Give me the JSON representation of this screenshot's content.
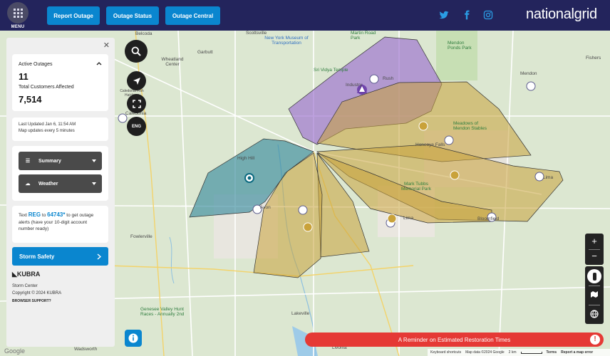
{
  "header": {
    "menu_label": "MENU",
    "nav": [
      "Report Outage",
      "Outage Status",
      "Outage Central"
    ],
    "brand": "nationalgrid",
    "social_icons": [
      "twitter-icon",
      "facebook-icon",
      "instagram-icon"
    ]
  },
  "panel": {
    "active_outages_label": "Active Outages",
    "active_outages": "11",
    "customers_label": "Total Customers Affected",
    "customers": "7,514",
    "last_updated": "Last Updated Jan 6, 11:54 AM",
    "update_freq": "Map updates every 5 minutes",
    "summary_label": "Summary",
    "weather_label": "Weather",
    "text_prefix": "Text",
    "text_keyword": "REG",
    "text_to": "to",
    "text_number": "64743*",
    "text_suffix": "to get outage alerts (have your 10-digit account number ready)",
    "storm_safety": "Storm Safety",
    "kubra": "KUBRA",
    "storm_center": "Storm Center",
    "copyright": "Copyright © 2024 KUBRA",
    "browser_support": "BROWSER SUPPORT?"
  },
  "controls": {
    "lang": "ENG",
    "zoom_in": "+",
    "zoom_out": "−"
  },
  "banner": {
    "reminder": "A Reminder on Estimated Restoration Times"
  },
  "map_footer": {
    "shortcuts": "Keyboard shortcuts",
    "map_data": "Map data ©2024 Google",
    "scale": "2 km",
    "terms": "Terms",
    "report": "Report a map error",
    "google": "Google"
  },
  "map_labels": [
    "Belcoda",
    "Scottsville",
    "New York Museum of Transportation",
    "Martin Road Park",
    "Garbutt",
    "Wheatland Center",
    "Sri Vidya Temple",
    "Rush",
    "Industry",
    "Caledonia",
    "Caledonia Fish Hatchery",
    "High Hill",
    "Fowlerville",
    "Genesee Valley Hunt Races - Annually 2nd",
    "Lima",
    "Mark Tubbs Memorial Park",
    "Honeoye Falls",
    "Meadows of Mendon Stables",
    "Bloomfield",
    "Lakeville",
    "Livonia",
    "Wadsworth",
    "Mendon",
    "Fishers",
    "Mendon Ponds Park",
    "Avon",
    "Lima"
  ],
  "colors": {
    "header_bg": "#23245c",
    "accent": "#0a86cf",
    "alert": "#e53935",
    "outage_teal": "#3a8c9e",
    "outage_purple": "#9b6fd0",
    "outage_gold": "#c9a23a"
  }
}
